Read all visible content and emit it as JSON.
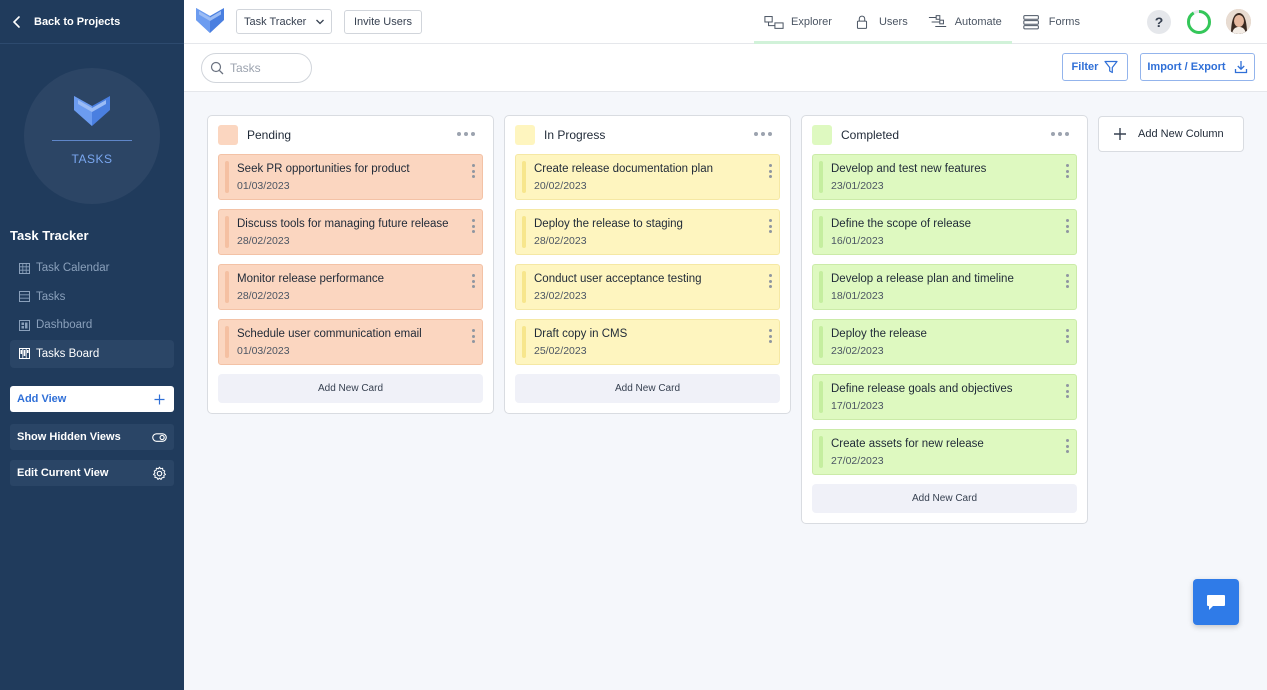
{
  "sidebar": {
    "back_label": "Back to Projects",
    "logo_text": "TASKS",
    "project_title": "Task Tracker",
    "nav_items": [
      {
        "label": "Task Calendar",
        "icon": "calendar-icon"
      },
      {
        "label": "Tasks",
        "icon": "table-icon"
      },
      {
        "label": "Dashboard",
        "icon": "dashboard-icon"
      },
      {
        "label": "Tasks Board",
        "icon": "board-icon"
      }
    ],
    "add_view_label": "Add View",
    "show_hidden_label": "Show Hidden Views",
    "edit_view_label": "Edit Current View"
  },
  "topbar": {
    "project_select": "Task Tracker",
    "invite_label": "Invite Users",
    "tabs": [
      {
        "label": "Explorer",
        "icon": "explorer-icon"
      },
      {
        "label": "Users",
        "icon": "lock-icon"
      },
      {
        "label": "Automate",
        "icon": "automate-icon"
      },
      {
        "label": "Forms",
        "icon": "forms-icon"
      }
    ],
    "help_label": "?"
  },
  "toolbar": {
    "search_placeholder": "Tasks",
    "filter_label": "Filter",
    "import_label": "Import / Export"
  },
  "board": {
    "columns": [
      {
        "title": "Pending",
        "color": "#fbd6c0",
        "cards": [
          {
            "title": "Seek PR opportunities for product",
            "date": "01/03/2023"
          },
          {
            "title": "Discuss tools for managing future release",
            "date": "28/02/2023"
          },
          {
            "title": "Monitor release performance",
            "date": "28/02/2023"
          },
          {
            "title": "Schedule user communication email",
            "date": "01/03/2023"
          }
        ],
        "add_card_label": "Add New Card"
      },
      {
        "title": "In Progress",
        "color": "#fef5bf",
        "cards": [
          {
            "title": "Create release documentation plan",
            "date": "20/02/2023"
          },
          {
            "title": "Deploy the release to staging",
            "date": "28/02/2023"
          },
          {
            "title": "Conduct user acceptance testing",
            "date": "23/02/2023"
          },
          {
            "title": "Draft copy in CMS",
            "date": "25/02/2023"
          }
        ],
        "add_card_label": "Add New Card"
      },
      {
        "title": "Completed",
        "color": "#def9c0",
        "cards": [
          {
            "title": "Develop and test new features",
            "date": "23/01/2023"
          },
          {
            "title": "Define the scope of release",
            "date": "16/01/2023"
          },
          {
            "title": "Develop a release plan and timeline",
            "date": "18/01/2023"
          },
          {
            "title": "Deploy the release",
            "date": "23/02/2023"
          },
          {
            "title": "Define release goals and objectives",
            "date": "17/01/2023"
          },
          {
            "title": "Create assets for new release",
            "date": "27/02/2023"
          }
        ],
        "add_card_label": "Add New Card"
      }
    ],
    "add_column_label": "Add New Column"
  },
  "colors": {
    "sidebar_bg": "#203b5c",
    "accent": "#2f6fd7",
    "chat_button": "#2f7be8"
  }
}
